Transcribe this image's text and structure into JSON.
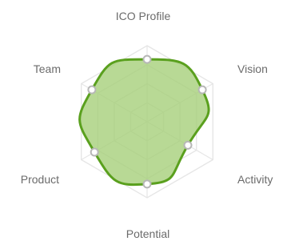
{
  "chart_data": {
    "type": "radar",
    "axes": [
      "ICO Profile",
      "Vision",
      "Activity",
      "Potential",
      "Product",
      "Team"
    ],
    "series": [
      {
        "values": [
          0.82,
          0.84,
          0.62,
          0.82,
          0.8,
          0.84
        ]
      }
    ],
    "range": [
      0,
      1
    ],
    "grid_levels": 4,
    "colors": {
      "fill": "#a6d07a",
      "stroke": "#5aa01e",
      "grid": "#e6e6e6",
      "point_fill": "#ffffff",
      "point_stroke": "#b7b7b7",
      "label": "#6b6b6b"
    }
  }
}
